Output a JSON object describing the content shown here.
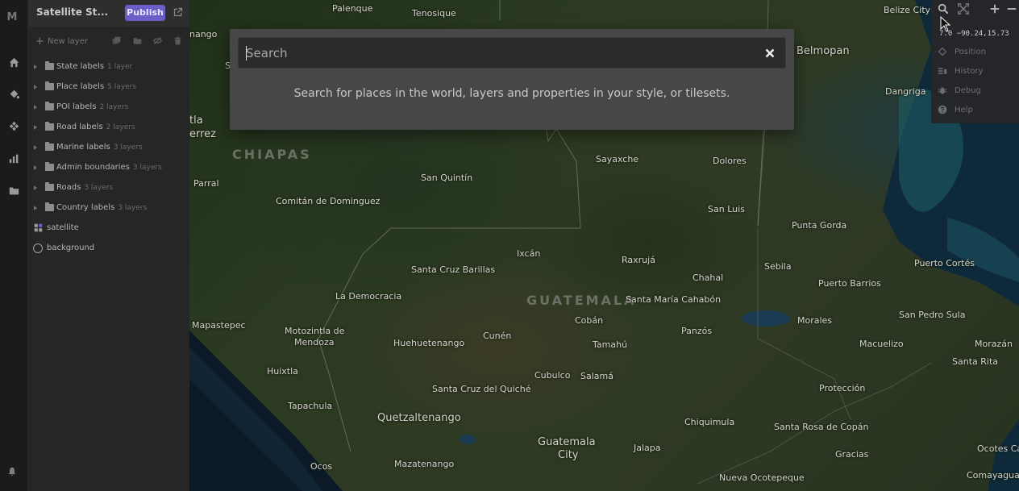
{
  "sidebar": {
    "logo": "M",
    "nav": [
      "home-icon",
      "paint-bucket-icon",
      "components-icon",
      "stats-icon",
      "folder-icon"
    ],
    "bell_icon": "bell-icon"
  },
  "panel": {
    "style_name": "Satellite St...",
    "publish_label": "Publish",
    "new_layer_label": "New layer",
    "groups": [
      {
        "name": "State labels",
        "count": "1 layer"
      },
      {
        "name": "Place labels",
        "count": "5 layers"
      },
      {
        "name": "POI labels",
        "count": "2 layers"
      },
      {
        "name": "Road labels",
        "count": "2 layers"
      },
      {
        "name": "Marine labels",
        "count": "3 layers"
      },
      {
        "name": "Admin boundaries",
        "count": "3 layers"
      },
      {
        "name": "Roads",
        "count": "3 layers"
      },
      {
        "name": "Country labels",
        "count": "3 layers"
      }
    ],
    "single_layers": [
      {
        "name": "satellite",
        "icon": "raster-icon"
      },
      {
        "name": "background",
        "icon": "background-icon"
      }
    ]
  },
  "search": {
    "placeholder": "Search",
    "hint": "Search for places in the world, layers and properties in your style, or tilesets."
  },
  "map_tools": {
    "coords": "7.0 −90.24,15.73",
    "items": [
      "Position",
      "History",
      "Debug",
      "Help"
    ]
  },
  "map": {
    "places": [
      "Palenque",
      "Tenosique",
      "Belize City",
      "Belmopan",
      "Dangriga",
      "Sayaxche",
      "Dolores",
      "San Quintín",
      "Comitán de Dominguez",
      "San Luis",
      "Punta Gorda",
      "Ixcán",
      "Raxrujá",
      "Santa Cruz Barillas",
      "Chahal",
      "Sebila",
      "Puerto Cortés",
      "Puerto Barrios",
      "La Democracia",
      "Santa María Cahabón",
      "Cobán",
      "Panzós",
      "Morales",
      "San Pedro Sula",
      "Mapastepec",
      "Motozintla de",
      "Mendoza",
      "Huehuetenango",
      "Cunén",
      "Tamahú",
      "Macuelizo",
      "Morazán",
      "Huixtla",
      "Cubulco",
      "Salamá",
      "Santa Rita",
      "Santa Cruz del Quiché",
      "Protección",
      "Tapachula",
      "Quetzaltenango",
      "Chiquimula",
      "Santa Rosa de Copán",
      "Guatemala",
      "City",
      "Jalapa",
      "Gracias",
      "Ocotes Ca",
      "Ocos",
      "Mazatenango",
      "Nueva Ocotepeque",
      "Comayagua",
      "Parral",
      "nango",
      "tla",
      "errez",
      "S"
    ],
    "regions": [
      "CHIAPAS",
      "GUATEMALA"
    ]
  }
}
